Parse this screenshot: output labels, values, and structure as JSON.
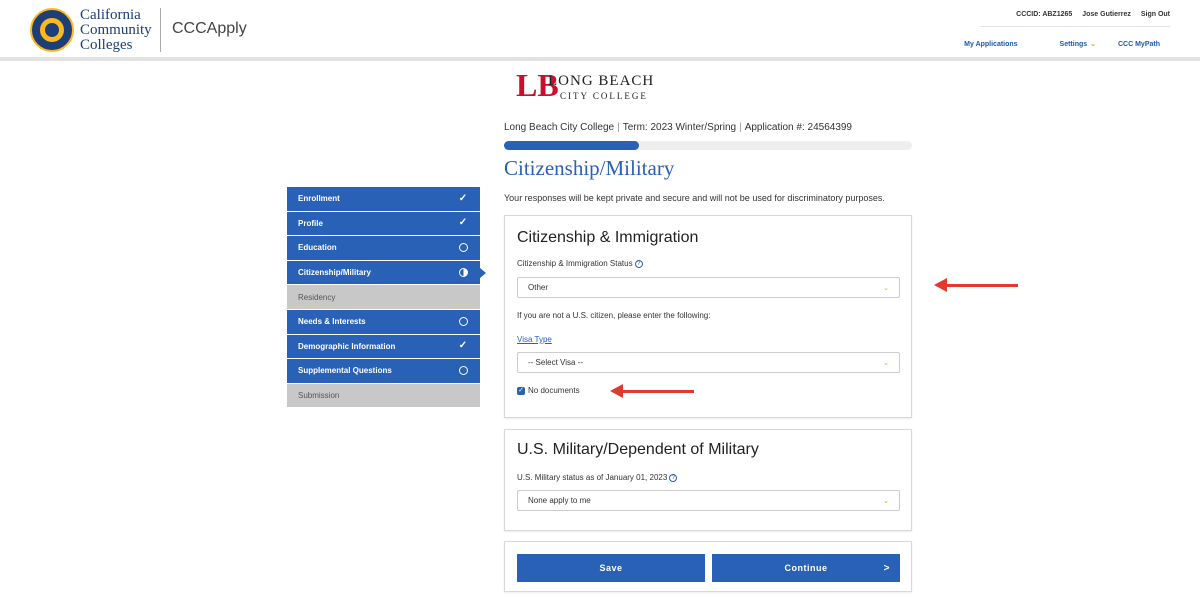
{
  "header": {
    "org_line1": "California",
    "org_line2": "Community",
    "org_line3": "Colleges",
    "app_name": "CCCApply",
    "cccid": "CCCID: ABZ1265",
    "user_name": "Jose Gutierrez",
    "sign_out": "Sign Out",
    "nav": {
      "my_applications": "My Applications",
      "settings": "Settings",
      "mypath": "CCC MyPath"
    }
  },
  "college": {
    "name": "LONG BEACH",
    "sub": "CITY COLLEGE"
  },
  "app_info": {
    "college": "Long Beach City College",
    "term": "Term: 2023 Winter/Spring",
    "application": "Application #: 24564399",
    "progress": 0.33
  },
  "page": {
    "title": "Citizenship/Military",
    "privacy_note": "Your responses will be kept private and secure and will not be used for discriminatory purposes."
  },
  "sidebar": {
    "items": [
      {
        "label": "Enrollment",
        "status": "complete"
      },
      {
        "label": "Profile",
        "status": "complete"
      },
      {
        "label": "Education",
        "status": "incomplete"
      },
      {
        "label": "Citizenship/Military",
        "status": "in-progress"
      },
      {
        "label": "Residency",
        "status": "disabled"
      },
      {
        "label": "Needs & Interests",
        "status": "incomplete"
      },
      {
        "label": "Demographic Information",
        "status": "complete"
      },
      {
        "label": "Supplemental Questions",
        "status": "incomplete"
      },
      {
        "label": "Submission",
        "status": "disabled"
      }
    ]
  },
  "citizenship": {
    "title": "Citizenship & Immigration",
    "status_label": "Citizenship & Immigration Status",
    "status_value": "Other",
    "note": "If you are not a U.S. citizen, please enter the following:",
    "visa_label": "Visa Type",
    "visa_value": "-- Select Visa --",
    "no_docs_label": "No documents",
    "no_docs_checked": true
  },
  "military": {
    "title": "U.S. Military/Dependent of Military",
    "status_label": "U.S. Military status as of January 01, 2023",
    "status_value": "None apply to me"
  },
  "buttons": {
    "save": "Save",
    "continue": "Continue",
    "continue_arrow": ">"
  },
  "colors": {
    "primary": "#2861b6",
    "accent": "#e8a317",
    "annotation": "#e03a2c"
  }
}
